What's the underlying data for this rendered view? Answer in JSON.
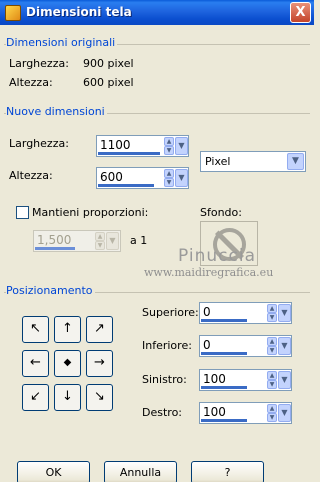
{
  "window": {
    "title": "Dimensioni tela",
    "close_label": "X"
  },
  "original_dimensions": {
    "heading": "Dimensioni originali",
    "width_label": "Larghezza:",
    "width_value": "900 pixel",
    "height_label": "Altezza:",
    "height_value": "600 pixel"
  },
  "new_dimensions": {
    "heading": "Nuove dimensioni",
    "width_label": "Larghezza:",
    "width_value": "1100",
    "height_label": "Altezza:",
    "height_value": "600",
    "unit": "Pixel",
    "keep_proportions_label": "Mantieni proporzioni:",
    "keep_proportions_checked": false,
    "ratio_value": "1,500",
    "ratio_suffix": "a 1",
    "background_label": "Sfondo:"
  },
  "watermark": {
    "line1": "Pinuccia",
    "line2": "www.maidiregrafica.eu"
  },
  "positioning": {
    "heading": "Posizionamento",
    "grid": [
      [
        "↖",
        "↑",
        "↗"
      ],
      [
        "←",
        "◆",
        "→"
      ],
      [
        "↙",
        "↓",
        "↘"
      ]
    ],
    "top_label": "Superiore:",
    "top_value": "0",
    "bottom_label": "Inferiore:",
    "bottom_value": "0",
    "left_label": "Sinistro:",
    "left_value": "100",
    "right_label": "Destro:",
    "right_value": "100"
  },
  "buttons": {
    "ok": "OK",
    "cancel": "Annulla",
    "help": "?"
  },
  "colors": {
    "title_bar": "#0a5bd8",
    "group_heading": "#0046d5",
    "dialog_bg": "#ece9d8"
  },
  "icons": {
    "spinner": "up-down-arrows-icon",
    "dropdown": "chevron-down-icon",
    "background": "no-entry-icon"
  }
}
